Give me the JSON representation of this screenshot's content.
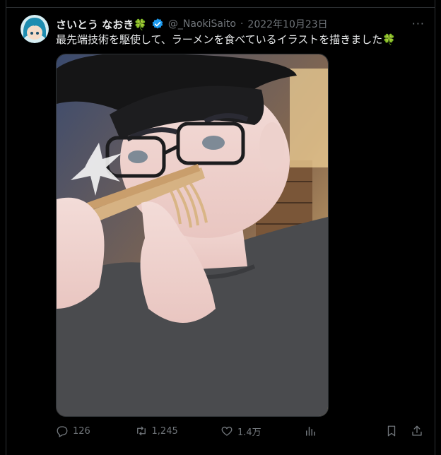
{
  "tweet": {
    "author_name": "さいとう なおき",
    "author_emoji": "🍀",
    "handle": "@_NaokiSaito",
    "separator": "·",
    "date": "2022年10月23日",
    "text": "最先端技術を駆使して、ラーメンを食べているイラストを描きました🍀",
    "more_label": "···"
  },
  "actions": {
    "replies": "126",
    "retweets": "1,245",
    "likes": "1.4万"
  },
  "colors": {
    "background": "#000000",
    "text": "#e7e9ea",
    "muted": "#71767b",
    "verified": "#1d9bf0",
    "border": "#2f3336"
  },
  "icons": [
    "avatar",
    "verified-badge-icon",
    "more-icon",
    "reply-icon",
    "retweet-icon",
    "like-icon",
    "views-icon",
    "bookmark-icon",
    "share-icon"
  ]
}
